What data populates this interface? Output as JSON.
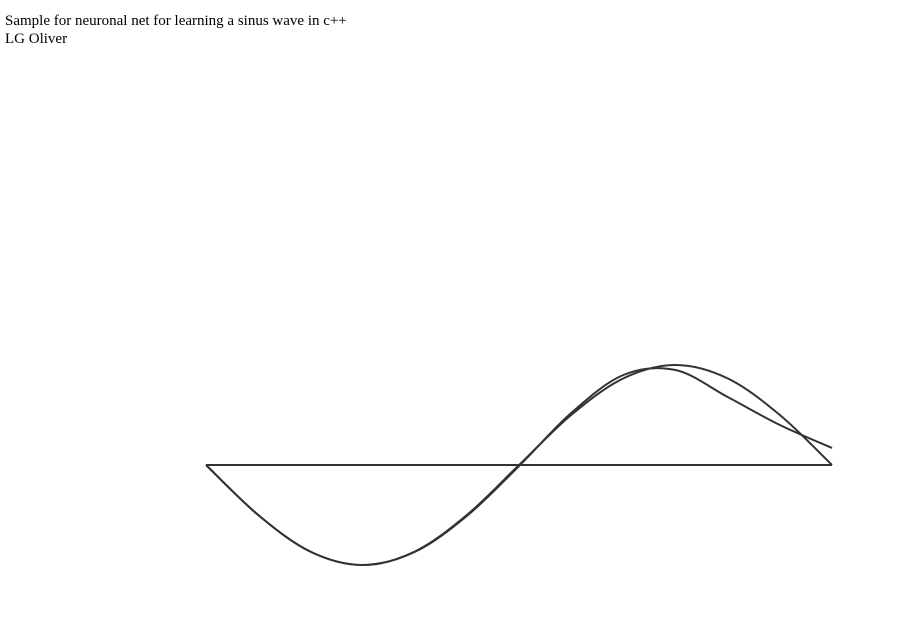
{
  "page": {
    "title_line": "Sample for neuronal net for learning a sinus wave in c++",
    "author_line": "LG Oliver"
  },
  "chart_data": {
    "type": "line",
    "title": "",
    "xlabel": "",
    "ylabel": "",
    "xlim": [
      0,
      6.283
    ],
    "ylim": [
      -1,
      1
    ],
    "grid": false,
    "line_color": "#333333",
    "series": [
      {
        "x": [
          0,
          0.524,
          1.047,
          1.571,
          2.094,
          2.618,
          3.142,
          3.665,
          4.189,
          4.712,
          5.236,
          5.76,
          6.283
        ],
        "y": [
          0,
          -0.5,
          -0.866,
          -1,
          -0.866,
          -0.5,
          0,
          0.5,
          0.866,
          1,
          0.866,
          0.5,
          0
        ]
      },
      {
        "x": [
          0,
          0.524,
          1.047,
          1.571,
          2.094,
          2.618,
          3.142,
          3.665,
          4.189,
          4.712,
          5.236,
          5.76,
          6.283
        ],
        "y": [
          0,
          -0.5,
          -0.866,
          -1,
          -0.87,
          -0.51,
          -0.01,
          0.52,
          0.9,
          0.95,
          0.68,
          0.4,
          0.17
        ]
      },
      {
        "x": [
          0,
          6.283
        ],
        "y": [
          0,
          0
        ]
      }
    ]
  }
}
